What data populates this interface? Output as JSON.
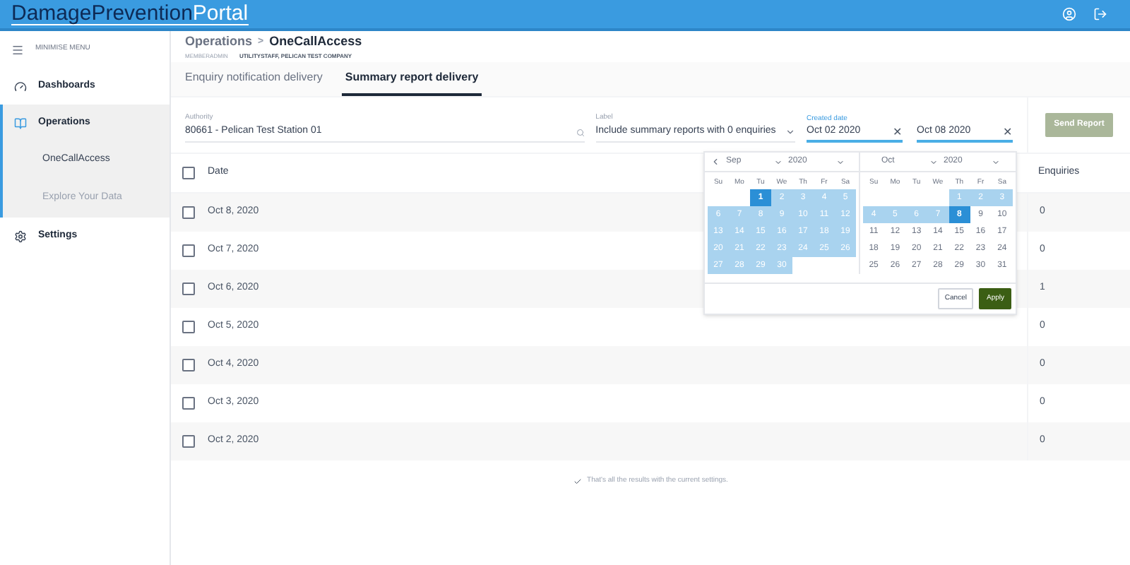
{
  "header": {
    "logo_dark": "DamagePrevention",
    "logo_light": "Portal"
  },
  "sidebar": {
    "minimise": "MINIMISE MENU",
    "items": [
      {
        "label": "Dashboards",
        "expanded": false
      },
      {
        "label": "Operations",
        "expanded": true,
        "children": [
          {
            "label": "OneCallAccess",
            "selected": true
          },
          {
            "label": "Explore Your Data",
            "selected": false
          }
        ]
      },
      {
        "label": "Settings",
        "expanded": false
      }
    ]
  },
  "breadcrumb": {
    "parent": "Operations",
    "separator": ">",
    "current": "OneCallAccess",
    "role": "MEMBERADMIN",
    "organisation": "UTILITYSTAFF, PELICAN TEST COMPANY"
  },
  "tabs": [
    {
      "label": "Enquiry notification delivery",
      "selected": false
    },
    {
      "label": "Summary report delivery",
      "selected": true
    }
  ],
  "filters": {
    "authority": {
      "label": "Authority",
      "value": "80661 - Pelican Test Station 01"
    },
    "report_label": {
      "label": "Label",
      "value": "Include summary reports with 0 enquiries"
    },
    "created_date": {
      "label": "Created date",
      "from": "Oct 02 2020",
      "to": "Oct 08 2020",
      "clear": "✕"
    },
    "send_button": {
      "label": "Send Report",
      "disabled": true
    }
  },
  "table": {
    "select_all_checked": false,
    "columns": [
      "Date",
      "Enquiries"
    ],
    "rows": [
      {
        "date": "Oct 8, 2020",
        "enquiries": "0",
        "checked": false
      },
      {
        "date": "Oct 7, 2020",
        "enquiries": "0",
        "checked": false
      },
      {
        "date": "Oct 6, 2020",
        "enquiries": "1",
        "checked": false
      },
      {
        "date": "Oct 5, 2020",
        "enquiries": "0",
        "checked": false
      },
      {
        "date": "Oct 4, 2020",
        "enquiries": "0",
        "checked": false
      },
      {
        "date": "Oct 3, 2020",
        "enquiries": "0",
        "checked": false
      },
      {
        "date": "Oct 2, 2020",
        "enquiries": "0",
        "checked": false
      }
    ]
  },
  "end_message": "That's all the results with the current settings.",
  "date_picker": {
    "months": [
      {
        "month": "Sep",
        "year": "2020",
        "weekdays": [
          "Su",
          "Mo",
          "Tu",
          "We",
          "Th",
          "Fr",
          "Sa"
        ],
        "weeks": [
          [
            {
              "kind": "blank"
            },
            {
              "kind": "blank"
            },
            {
              "day": "1",
              "kind": "edge"
            },
            {
              "day": "2",
              "kind": "range"
            },
            {
              "day": "3",
              "kind": "range"
            },
            {
              "day": "4",
              "kind": "range"
            },
            {
              "day": "5",
              "kind": "range"
            }
          ],
          [
            {
              "day": "6",
              "kind": "range"
            },
            {
              "day": "7",
              "kind": "range"
            },
            {
              "day": "8",
              "kind": "range"
            },
            {
              "day": "9",
              "kind": "range"
            },
            {
              "day": "10",
              "kind": "range"
            },
            {
              "day": "11",
              "kind": "range"
            },
            {
              "day": "12",
              "kind": "range"
            }
          ],
          [
            {
              "day": "13",
              "kind": "range"
            },
            {
              "day": "14",
              "kind": "range"
            },
            {
              "day": "15",
              "kind": "range"
            },
            {
              "day": "16",
              "kind": "range"
            },
            {
              "day": "17",
              "kind": "range"
            },
            {
              "day": "18",
              "kind": "range"
            },
            {
              "day": "19",
              "kind": "range"
            }
          ],
          [
            {
              "day": "20",
              "kind": "range"
            },
            {
              "day": "21",
              "kind": "range"
            },
            {
              "day": "22",
              "kind": "range"
            },
            {
              "day": "23",
              "kind": "range"
            },
            {
              "day": "24",
              "kind": "range"
            },
            {
              "day": "25",
              "kind": "range"
            },
            {
              "day": "26",
              "kind": "range"
            }
          ],
          [
            {
              "day": "27",
              "kind": "range"
            },
            {
              "day": "28",
              "kind": "range"
            },
            {
              "day": "29",
              "kind": "range"
            },
            {
              "day": "30",
              "kind": "range"
            }
          ]
        ]
      },
      {
        "month": "Oct",
        "year": "2020",
        "weekdays": [
          "Su",
          "Mo",
          "Tu",
          "We",
          "Th",
          "Fr",
          "Sa"
        ],
        "weeks": [
          [
            {
              "kind": "blank"
            },
            {
              "kind": "blank"
            },
            {
              "kind": "blank"
            },
            {
              "kind": "blank"
            },
            {
              "day": "1",
              "kind": "range"
            },
            {
              "day": "2",
              "kind": "range"
            },
            {
              "day": "3",
              "kind": "range"
            }
          ],
          [
            {
              "day": "4",
              "kind": "range"
            },
            {
              "day": "5",
              "kind": "range"
            },
            {
              "day": "6",
              "kind": "range"
            },
            {
              "day": "7",
              "kind": "range"
            },
            {
              "day": "8",
              "kind": "edge"
            },
            {
              "day": "9",
              "kind": "normal"
            },
            {
              "day": "10",
              "kind": "normal"
            }
          ],
          [
            {
              "day": "11",
              "kind": "normal"
            },
            {
              "day": "12",
              "kind": "normal"
            },
            {
              "day": "13",
              "kind": "normal"
            },
            {
              "day": "14",
              "kind": "normal"
            },
            {
              "day": "15",
              "kind": "normal"
            },
            {
              "day": "16",
              "kind": "normal"
            },
            {
              "day": "17",
              "kind": "normal"
            }
          ],
          [
            {
              "day": "18",
              "kind": "normal"
            },
            {
              "day": "19",
              "kind": "normal"
            },
            {
              "day": "20",
              "kind": "normal"
            },
            {
              "day": "21",
              "kind": "normal"
            },
            {
              "day": "22",
              "kind": "normal"
            },
            {
              "day": "23",
              "kind": "normal"
            },
            {
              "day": "24",
              "kind": "normal"
            }
          ],
          [
            {
              "day": "25",
              "kind": "normal"
            },
            {
              "day": "26",
              "kind": "normal"
            },
            {
              "day": "27",
              "kind": "normal"
            },
            {
              "day": "28",
              "kind": "normal"
            },
            {
              "day": "29",
              "kind": "normal"
            },
            {
              "day": "30",
              "kind": "normal"
            },
            {
              "day": "31",
              "kind": "normal"
            }
          ]
        ]
      }
    ],
    "cancel": "Cancel",
    "apply": "Apply"
  }
}
